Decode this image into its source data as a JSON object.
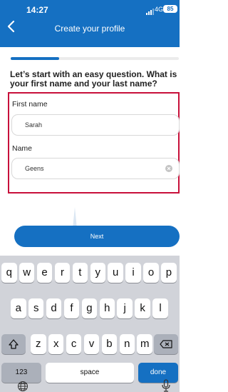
{
  "status_bar": {
    "time": "14:27",
    "network": "4G",
    "battery": "85"
  },
  "header": {
    "title": "Create your profile",
    "back_icon": "chevron-left-icon"
  },
  "progress": {
    "fraction": 0.29
  },
  "question": "Let’s start with an easy question. What is your first name and your last name?",
  "form": {
    "first_name": {
      "label": "First name",
      "value": "Sarah"
    },
    "last_name": {
      "label": "Name",
      "value": "Geens"
    }
  },
  "next_button": "Next",
  "keyboard": {
    "row1": [
      "q",
      "w",
      "e",
      "r",
      "t",
      "y",
      "u",
      "i",
      "o",
      "p"
    ],
    "row2": [
      "a",
      "s",
      "d",
      "f",
      "g",
      "h",
      "j",
      "k",
      "l"
    ],
    "row3": [
      "z",
      "x",
      "c",
      "v",
      "b",
      "n",
      "m"
    ],
    "numbers_key": "123",
    "space_key": "space",
    "done_key": "done"
  },
  "colors": {
    "brand": "#1570c2",
    "highlight": "#c8103a"
  }
}
